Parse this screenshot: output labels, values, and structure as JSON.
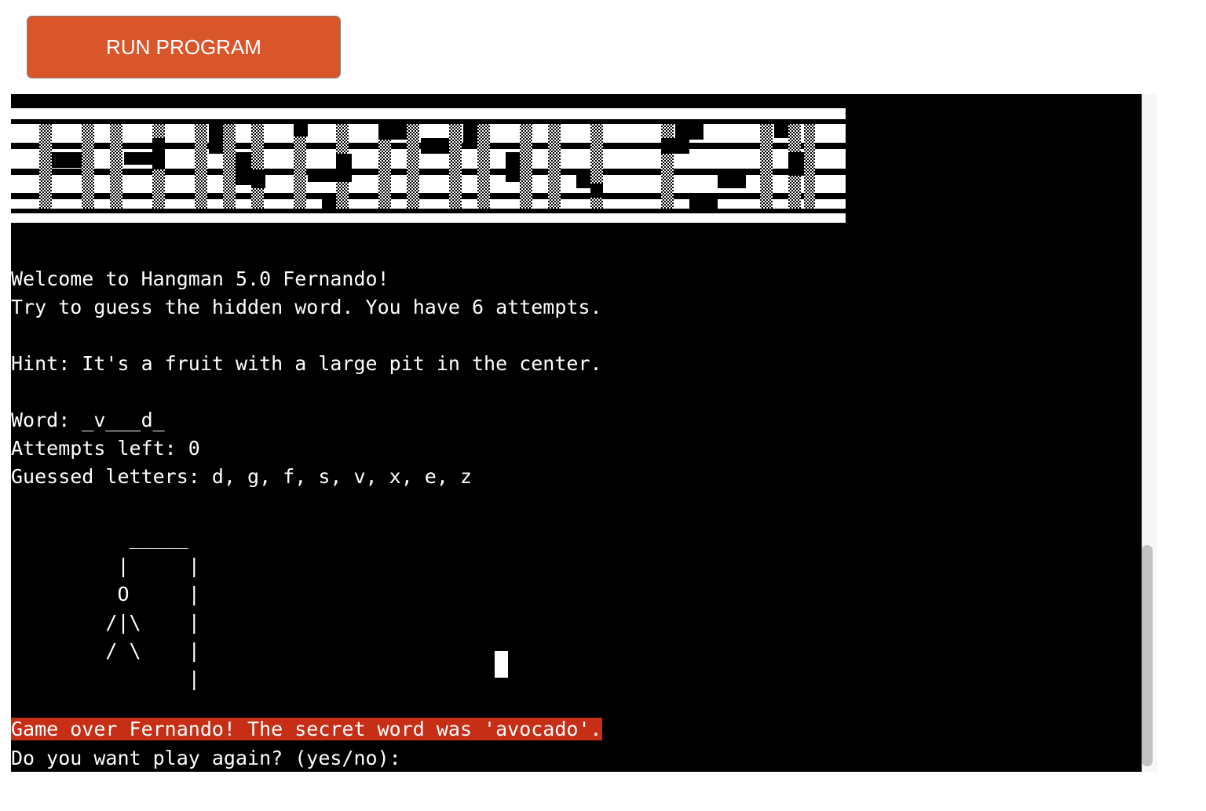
{
  "toolbar": {
    "run_label": "RUN PROGRAM",
    "run_color": "#d9562a"
  },
  "terminal": {
    "banner_text": "HANGMAN 5.0",
    "welcome": "Welcome to Hangman 5.0 Fernando!",
    "instructions": "Try to guess the hidden word. You have 6 attempts.",
    "hint": "Hint: It's a fruit with a large pit in the center.",
    "word": "Word: _v___d_",
    "attempts": "Attempts left: 0",
    "guessed": "Guessed letters: d, g, f, s, v, x, e, z",
    "gallows": [
      "          _____",
      "         |     |",
      "         O     |",
      "        /|\\    |",
      "        / \\    |",
      "               |"
    ],
    "game_over": "Game over Fernando! The secret word was 'avocado'.",
    "game_over_color": "#c62e16",
    "prompt": "Do you want play again? (yes/no): "
  }
}
